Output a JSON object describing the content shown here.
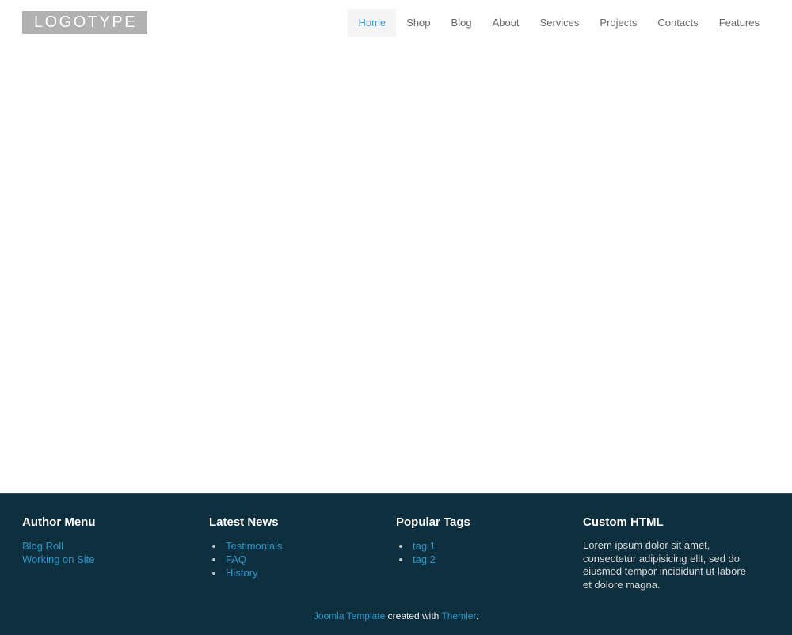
{
  "header": {
    "logo": "LOGOTYPE",
    "nav": [
      {
        "label": "Home",
        "active": true
      },
      {
        "label": "Shop",
        "active": false
      },
      {
        "label": "Blog",
        "active": false
      },
      {
        "label": "About",
        "active": false
      },
      {
        "label": "Services",
        "active": false
      },
      {
        "label": "Projects",
        "active": false
      },
      {
        "label": "Contacts",
        "active": false
      },
      {
        "label": "Features",
        "active": false
      }
    ]
  },
  "footer": {
    "columns": [
      {
        "title": "Author Menu",
        "links": [
          "Blog Roll",
          "Working on Site"
        ]
      },
      {
        "title": "Latest News",
        "links": [
          "Testimonials",
          "FAQ",
          "History"
        ]
      },
      {
        "title": "Popular Tags",
        "links": [
          "tag 1",
          "tag 2"
        ]
      },
      {
        "title": "Custom HTML",
        "text": "Lorem ipsum dolor sit amet, consectetur adipisicing elit, sed do eiusmod tempor incididunt ut labore et dolore magna."
      }
    ],
    "credit": {
      "link1": "Joomla Template",
      "middle": " created with ",
      "link2": "Themler",
      "suffix": "."
    }
  },
  "colors": {
    "footer_bg": "#0e2f3e",
    "footer_link": "#2e96c8",
    "nav_link": "#666666",
    "nav_active_text": "#4b97cf",
    "nav_active_bg": "#f5f5f5",
    "logo_bg": "#b1b1b1"
  }
}
